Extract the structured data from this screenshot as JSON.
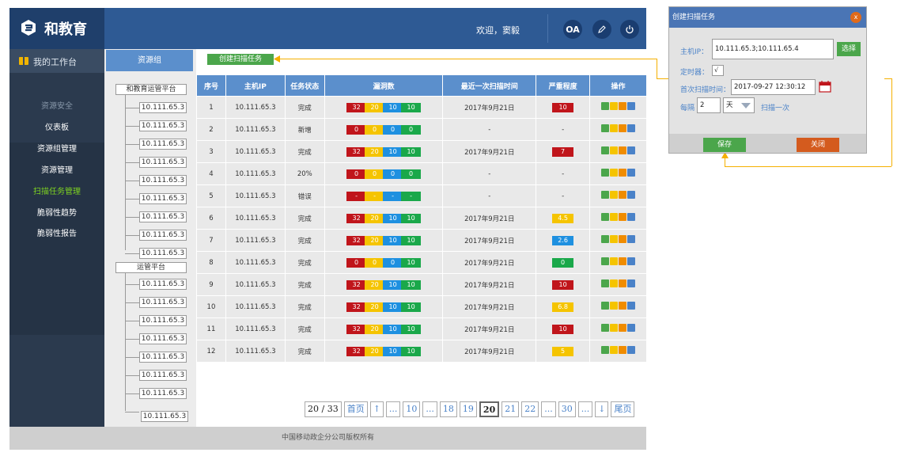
{
  "header": {
    "logo_text": "和教育",
    "welcome": "欢迎，窦毅",
    "oa_label": "OA"
  },
  "sidebar": {
    "workspace": "我的工作台",
    "section": "资源安全",
    "items": [
      "仪表板",
      "资源组管理",
      "资源管理",
      "扫描任务管理",
      "脆弱性趋势",
      "脆弱性报告"
    ],
    "active_color": "#7ed321"
  },
  "tree": {
    "tab": "资源组",
    "groups": [
      {
        "name": "和教育运管平台",
        "leaves": [
          "10.111.65.3",
          "10.111.65.3",
          "10.111.65.3",
          "10.111.65.3",
          "10.111.65.3",
          "10.111.65.3",
          "10.111.65.3",
          "10.111.65.3",
          "10.111.65.3"
        ]
      },
      {
        "name": "运管平台",
        "leaves": [
          "10.111.65.3",
          "10.111.65.3",
          "10.111.65.3",
          "10.111.65.3",
          "10.111.65.3",
          "10.111.65.3",
          "10.111.65.3",
          "10.111.65.3"
        ]
      }
    ]
  },
  "main": {
    "create_label": "创建扫描任务"
  },
  "table": {
    "headers": [
      "序号",
      "主机IP",
      "任务状态",
      "漏洞数",
      "最近一次扫描时间",
      "严重程度",
      "操作"
    ],
    "rows": [
      {
        "no": "1",
        "ip": "10.111.65.3",
        "status": "完成",
        "v": [
          "32",
          "20",
          "10",
          "10"
        ],
        "time": "2017年9月21日",
        "sev": "10",
        "sevc": "#c0151b"
      },
      {
        "no": "2",
        "ip": "10.111.65.3",
        "status": "新增",
        "v": [
          "0",
          "0",
          "0",
          "0"
        ],
        "time": "-",
        "sev": "-",
        "sevc": ""
      },
      {
        "no": "3",
        "ip": "10.111.65.3",
        "status": "完成",
        "v": [
          "32",
          "20",
          "10",
          "10"
        ],
        "time": "2017年9月21日",
        "sev": "7",
        "sevc": "#c0151b"
      },
      {
        "no": "4",
        "ip": "10.111.65.3",
        "status": "20%",
        "v": [
          "0",
          "0",
          "0",
          "0"
        ],
        "time": "-",
        "sev": "-",
        "sevc": ""
      },
      {
        "no": "5",
        "ip": "10.111.65.3",
        "status": "错误",
        "v": [
          "-",
          "-",
          "-",
          "-"
        ],
        "time": "-",
        "sev": "-",
        "sevc": ""
      },
      {
        "no": "6",
        "ip": "10.111.65.3",
        "status": "完成",
        "v": [
          "32",
          "20",
          "10",
          "10"
        ],
        "time": "2017年9月21日",
        "sev": "4.5",
        "sevc": "#f5c400"
      },
      {
        "no": "7",
        "ip": "10.111.65.3",
        "status": "完成",
        "v": [
          "32",
          "20",
          "10",
          "10"
        ],
        "time": "2017年9月21日",
        "sev": "2.6",
        "sevc": "#1e90e0"
      },
      {
        "no": "8",
        "ip": "10.111.65.3",
        "status": "完成",
        "v": [
          "0",
          "0",
          "0",
          "10"
        ],
        "time": "2017年9月21日",
        "sev": "0",
        "sevc": "#1aa84a"
      },
      {
        "no": "9",
        "ip": "10.111.65.3",
        "status": "完成",
        "v": [
          "32",
          "20",
          "10",
          "10"
        ],
        "time": "2017年9月21日",
        "sev": "10",
        "sevc": "#c0151b"
      },
      {
        "no": "10",
        "ip": "10.111.65.3",
        "status": "完成",
        "v": [
          "32",
          "20",
          "10",
          "10"
        ],
        "time": "2017年9月21日",
        "sev": "6.8",
        "sevc": "#f5c400"
      },
      {
        "no": "11",
        "ip": "10.111.65.3",
        "status": "完成",
        "v": [
          "32",
          "20",
          "10",
          "10"
        ],
        "time": "2017年9月21日",
        "sev": "10",
        "sevc": "#c0151b"
      },
      {
        "no": "12",
        "ip": "10.111.65.3",
        "status": "完成",
        "v": [
          "32",
          "20",
          "10",
          "10"
        ],
        "time": "2017年9月21日",
        "sev": "5",
        "sevc": "#f5c400"
      }
    ],
    "vuln_colors": [
      "#c0151b",
      "#f5c400",
      "#1e90e0",
      "#1aa84a"
    ]
  },
  "pager": {
    "info": "20 / 33",
    "first": "首页",
    "last": "尾页",
    "items": [
      "↑",
      "...",
      "10",
      "...",
      "18",
      "19",
      "20",
      "21",
      "22",
      "...",
      "30",
      "...",
      "↓"
    ],
    "current": "20"
  },
  "footer": {
    "text": "中国移动政企分公司版权所有"
  },
  "dialog": {
    "title": "创建扫描任务",
    "host_label": "主机IP：",
    "host_value": "10.111.65.3;10.111.65.4",
    "select_label": "选择",
    "timer_label": "定时器：",
    "timer_check": "√",
    "first_label": "首次扫描时间：",
    "first_value": "2017-09-27 12:30:12",
    "every_label": "每隔",
    "every_value": "2",
    "unit_value": "天",
    "scan_once": "扫描一次",
    "save_label": "保存",
    "close_label": "关闭"
  }
}
